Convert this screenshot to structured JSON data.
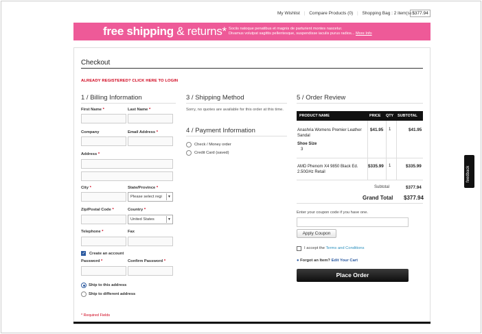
{
  "header": {
    "wishlist": "My Wishlist",
    "compare": "Compare Products (0)",
    "bag": "Shopping Bag :  2 item(s)",
    "bag_total": "$377.94"
  },
  "banner": {
    "bold": "free shipping",
    "light": " & returns*",
    "line1": "Sociis natoque penatibus et magnis de parturient montes nascetur.",
    "line2": "Divamus volutpat sagittis pellentesque, suspendisse iaculis purus radios...",
    "more_info": "More Info",
    "color": "#ee5a98"
  },
  "checkout": {
    "title": "Checkout",
    "register_link": "ALREADY REGISTERED? CLICK HERE TO LOGIN"
  },
  "billing": {
    "title": "1 / Billing Information",
    "first_name": "First Name",
    "last_name": "Last Name",
    "company": "Company",
    "email": "Email Address",
    "address": "Address",
    "city": "City",
    "state": "State/Province",
    "state_value": "Please select regi",
    "zip": "Zip/Postal Code",
    "country": "Country",
    "country_value": "United States",
    "telephone": "Telephone",
    "fax": "Fax",
    "create_account": "Create an account",
    "password": "Password",
    "confirm_password": "Confirm Password",
    "ship_this": "Ship to this address",
    "ship_different": "Ship to different address",
    "required": "* Required Fields",
    "asterisk": "*"
  },
  "shipping": {
    "title": "3 / Shipping Method",
    "note": "Sorry, no quotes are available for this order at this time."
  },
  "payment": {
    "title": "4 / Payment Information",
    "check": "Check / Money order",
    "credit": "Credit Card (saved)"
  },
  "review": {
    "title": "5 / Order Review",
    "columns": [
      "PRODUCT NAME",
      "PRICE",
      "QTY",
      "SUBTOTAL"
    ],
    "items": [
      {
        "name_line1": "Anashria Womens Premier Leather",
        "name_line2": "Sandal",
        "option_label": "Shoe Size",
        "option_value": "3",
        "price": "$41.95",
        "qty": "1",
        "subtotal": "$41.95"
      },
      {
        "name_line1": "AMD Phenom X4 9850 Black Ed.",
        "name_line2": "2.50GHz Retail",
        "price": "$335.99",
        "qty": "1",
        "subtotal": "$335.99"
      }
    ],
    "subtotal_label": "Subtotal",
    "subtotal_value": "$377.94",
    "grand_label": "Grand Total",
    "grand_value": "$377.94",
    "coupon_prompt": "Enter your coupon code if you have one.",
    "coupon_button": "Apply Coupon",
    "terms_prefix": "I accept the ",
    "terms_link": "Terms and Conditions",
    "forgot_prefix": "Forgot an Item? ",
    "forgot_link": "Edit Your Cart",
    "place_order": "Place Order"
  },
  "feedback": "feedback"
}
